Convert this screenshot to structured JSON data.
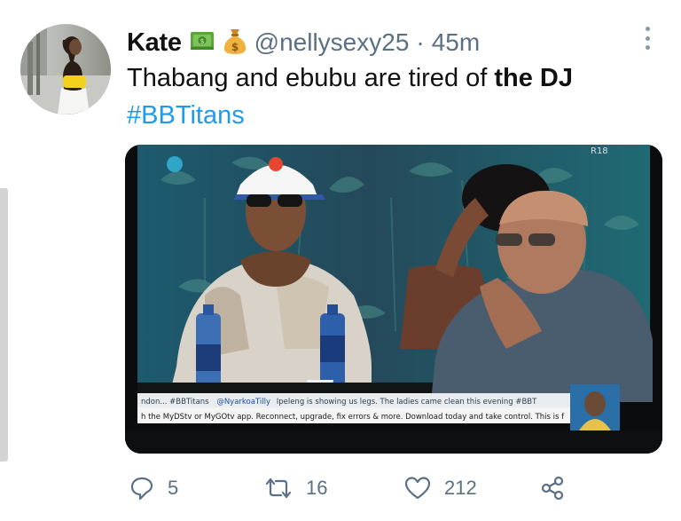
{
  "tweet": {
    "author": {
      "display_name": "Kate",
      "emojis": [
        "dollar-banknote",
        "money-bag"
      ],
      "handle": "@nellysexy25",
      "separator": "·",
      "time": "45m"
    },
    "text_plain": "Thabang and ebubu are tired of",
    "text_bold": "the DJ",
    "hashtag": "#BBTitans",
    "media": {
      "badge": "R18",
      "ticker_line1_prefix": "ndon... #BBTitans",
      "ticker_line1_handle": "@NyarkoaTilly",
      "ticker_line1_text": "Ipeleng is showing us legs. The ladies came clean this evening #BBT",
      "ticker_line2": "h the MyDStv or MyGOtv app. Reconnect, upgrade, fix errors & more. Download today and take control.  This is f"
    },
    "actions": {
      "reply_count": "5",
      "retweet_count": "16",
      "like_count": "212"
    }
  },
  "colors": {
    "text": "#111111",
    "secondary": "#5b7083",
    "link": "#1d9bf0"
  }
}
